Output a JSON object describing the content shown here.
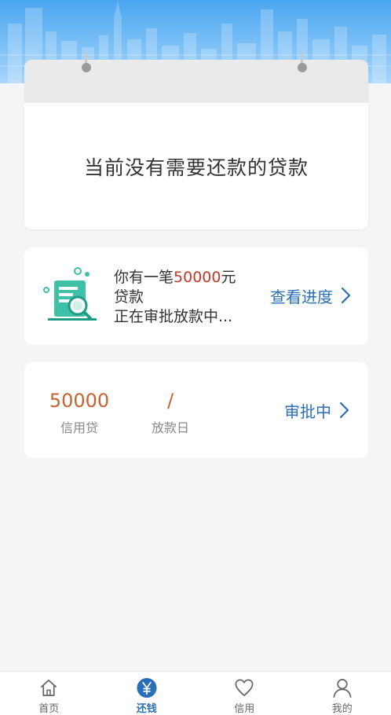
{
  "calendar": {
    "message": "当前没有需要还款的贷款"
  },
  "loan": {
    "line1_prefix": "你有一笔",
    "line1_amount": "50000",
    "line1_suffix": "元",
    "line2": "贷款",
    "line3": "正在审批放款中...",
    "link_label": "查看进度"
  },
  "credit": {
    "amount_value": "50000",
    "amount_label": "信用贷",
    "date_value": "/",
    "date_label": "放款日",
    "status_label": "审批中"
  },
  "tabs": [
    {
      "label": "首页",
      "icon": "home-icon"
    },
    {
      "label": "还钱",
      "icon": "yen-icon"
    },
    {
      "label": "信用",
      "icon": "heart-icon"
    },
    {
      "label": "我的",
      "icon": "user-icon"
    }
  ],
  "colors": {
    "accent_blue": "#2a6fb8",
    "amount_orange": "#c8622f",
    "amount_red": "#c0392b",
    "icon_teal": "#3fc1a8"
  }
}
